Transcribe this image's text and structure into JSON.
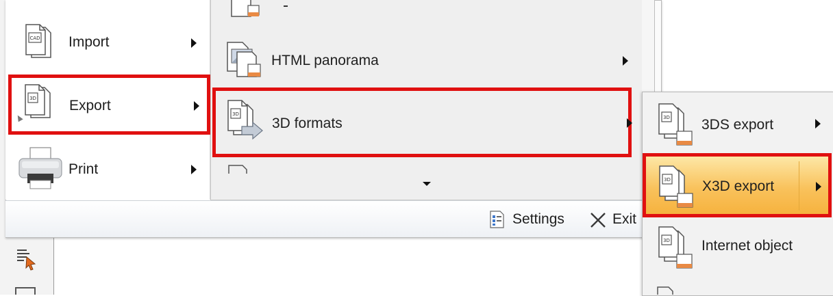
{
  "left_menu": {
    "items": [
      {
        "label": "Import"
      },
      {
        "label": "Export"
      },
      {
        "label": "Print"
      }
    ]
  },
  "export_submenu": {
    "items": [
      {
        "label": "HTML panorama"
      },
      {
        "label": "3D formats"
      }
    ]
  },
  "formats_submenu": {
    "items": [
      {
        "label": "3DS export"
      },
      {
        "label": "X3D export"
      },
      {
        "label": "Internet object"
      }
    ]
  },
  "footer": {
    "settings_label": "Settings",
    "exit_label": "Exit"
  },
  "icons": {
    "import": "cad-document-icon",
    "export": "3d-document-icon",
    "print": "printer-icon",
    "html_panorama": "panorama-document-icon",
    "formats": "3d-export-arrow-icon",
    "settings": "settings-icon",
    "exit": "close-icon"
  },
  "colors": {
    "highlight_box": "#e01010",
    "hover_gradient_top": "#fde8a8",
    "hover_gradient_bottom": "#f6b23e"
  }
}
